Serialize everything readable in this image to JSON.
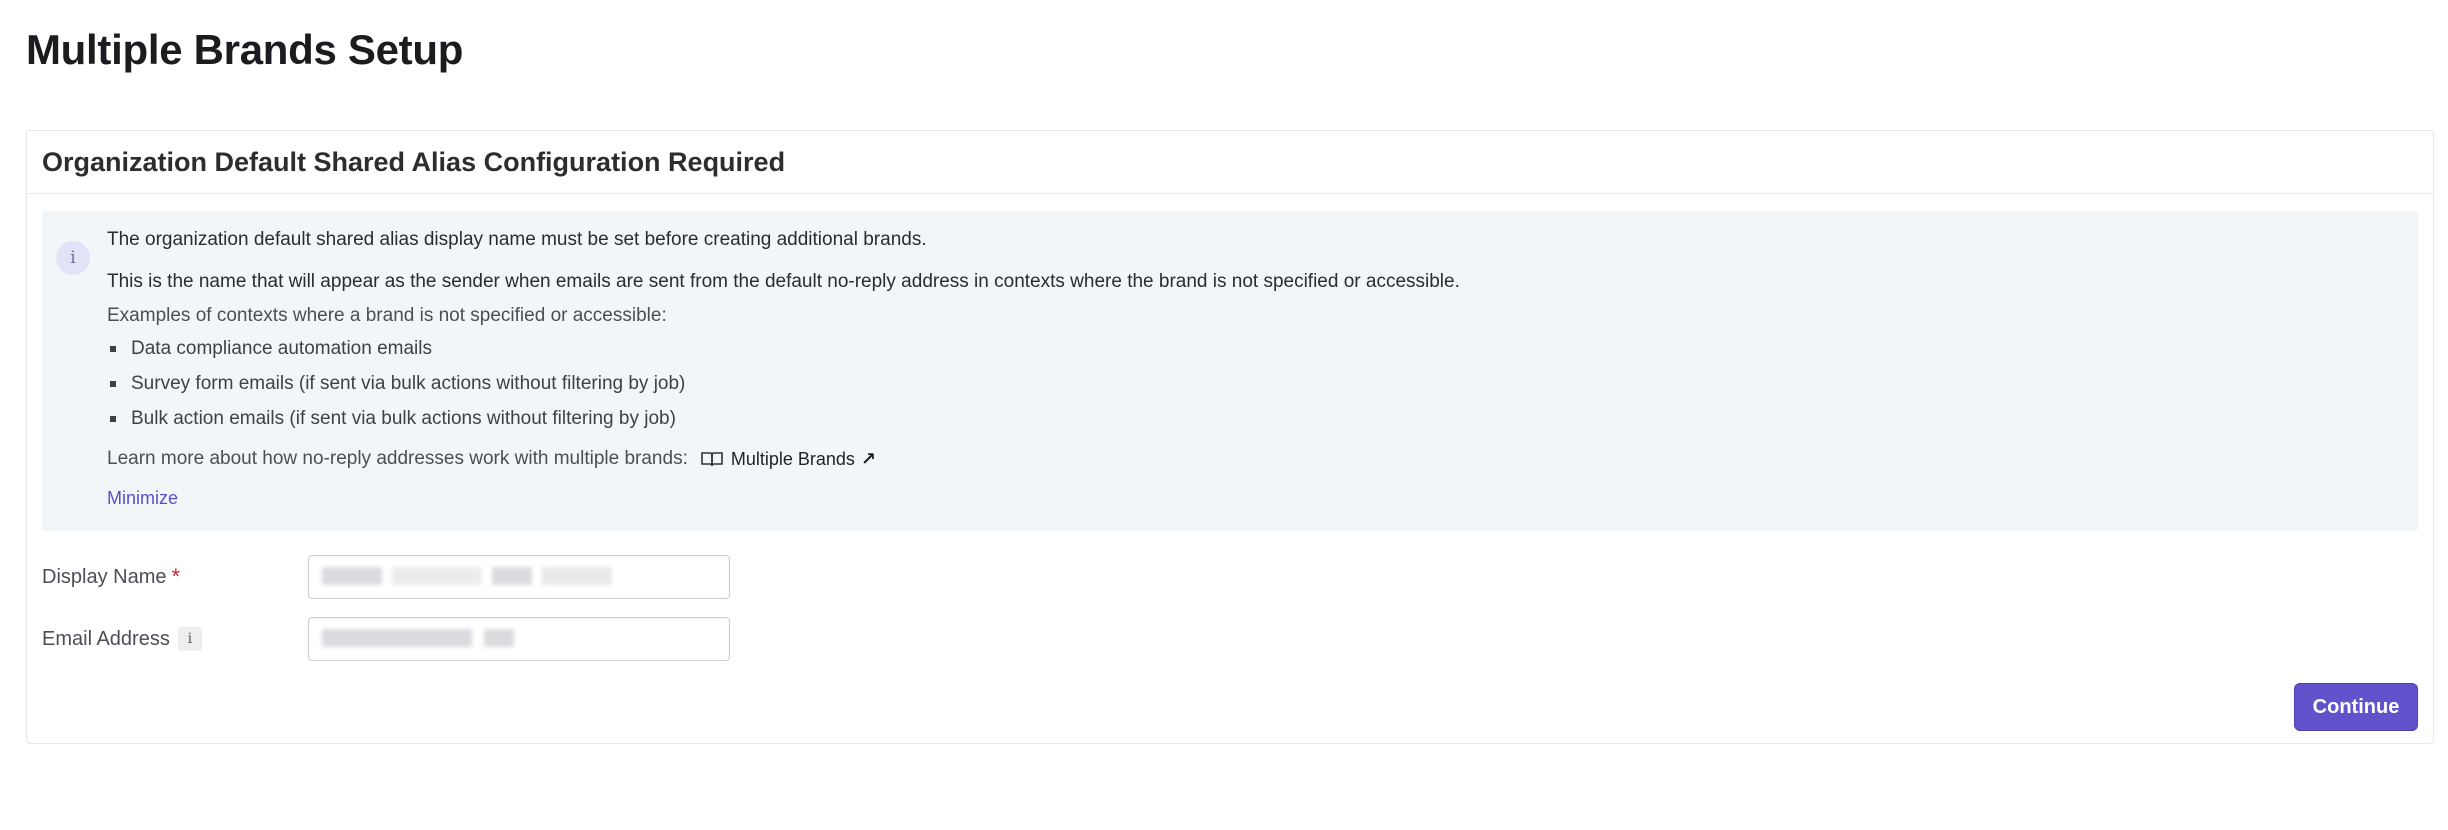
{
  "page": {
    "title": "Multiple Brands Setup"
  },
  "card": {
    "title": "Organization Default Shared Alias Configuration Required",
    "banner": {
      "icon": "info-icon",
      "line1": "The organization default shared alias display name must be set before creating additional brands.",
      "line2": "This is the name that will appear as the sender when emails are sent from the default no-reply address in contexts where the brand is not specified or accessible.",
      "examples_heading": "Examples of contexts where a brand is not specified or accessible:",
      "examples": [
        "Data compliance automation emails",
        "Survey form emails (if sent via bulk actions without filtering by job)",
        "Bulk action emails (if sent via bulk actions without filtering by job)"
      ],
      "learn_more": "Learn more about how no-reply addresses work with multiple brands:",
      "doc_link": "Multiple Brands",
      "minimize": "Minimize"
    },
    "form": {
      "display_name": {
        "label": "Display Name",
        "required_mark": "*",
        "value": ""
      },
      "email_address": {
        "label": "Email Address",
        "info_icon": "i",
        "value": ""
      }
    },
    "continue_label": "Continue"
  }
}
